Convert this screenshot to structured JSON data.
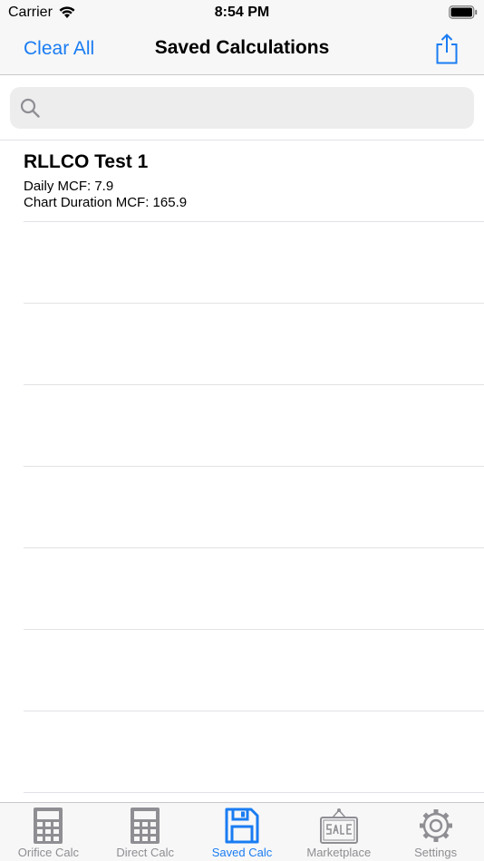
{
  "status": {
    "carrier": "Carrier",
    "time": "8:54 PM"
  },
  "nav": {
    "left_button": "Clear All",
    "title": "Saved Calculations",
    "right_icon": "share-icon"
  },
  "search": {
    "placeholder": "",
    "value": ""
  },
  "list": {
    "items": [
      {
        "title": "RLLCO Test 1",
        "line1": "Daily MCF: 7.9",
        "line2": "Chart Duration MCF: 165.9"
      }
    ]
  },
  "tabs": [
    {
      "label": "Orifice Calc",
      "icon": "calculator-icon"
    },
    {
      "label": "Direct Calc",
      "icon": "calculator-icon"
    },
    {
      "label": "Saved Calc",
      "icon": "floppy-disk-icon",
      "active": true
    },
    {
      "label": "Marketplace",
      "icon": "sale-sign-icon"
    },
    {
      "label": "Settings",
      "icon": "gear-icon"
    }
  ],
  "colors": {
    "accent": "#1a7cf2",
    "inactive": "#8e8e93",
    "bar_background": "#f7f7f7"
  }
}
